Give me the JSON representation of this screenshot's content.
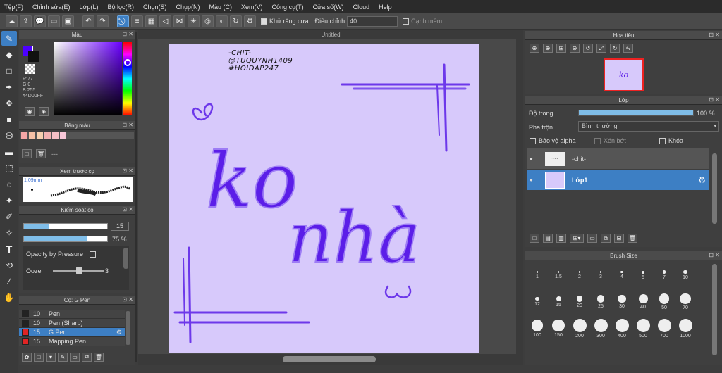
{
  "menu": [
    "Tệp(F)",
    "Chỉnh sửa(E)",
    "Lớp(L)",
    "Bộ lọc(R)",
    "Chọn(S)",
    "Chụp(N)",
    "Màu (C)",
    "Xem(V)",
    "Công cụ(T)",
    "Cửa sổ(W)",
    "Cloud",
    "Help"
  ],
  "toolbar": {
    "antialias_label": "Khử răng cưa",
    "adjust_label": "Điều chỉnh",
    "adjust_value": "40",
    "edge_label": "Cạnh mềm"
  },
  "color_panel": {
    "title": "Màu",
    "r": "R:77",
    "g": "G:0",
    "b": "B:255",
    "hex": "#4D00FF",
    "main_color": "#4d00ff"
  },
  "palette": {
    "title": "Bảng màu",
    "colors": [
      "#f4a6a6",
      "#f6c1a6",
      "#f7d0b0",
      "#f3b3b3",
      "#f5c0c6",
      "#f8c7d8"
    ]
  },
  "brush_preview": {
    "title": "Xem trước cọ",
    "size": "1.09mm"
  },
  "brush_control": {
    "title": "Kiểm soát cọ",
    "size_value": "15",
    "opacity_value": "75 %",
    "opacity_pressure": "Opacity by Pressure",
    "ooze_label": "Ooze",
    "ooze_value": "3",
    "size_fill": 0.3,
    "opacity_fill": 0.75
  },
  "brush_list": {
    "title": "Cọ: G Pen",
    "items": [
      {
        "size": "10",
        "name": "Pen",
        "color": "#222222"
      },
      {
        "size": "10",
        "name": "Pen (Sharp)",
        "color": "#222222"
      },
      {
        "size": "15",
        "name": "G Pen",
        "color": "#e02424"
      },
      {
        "size": "15",
        "name": "Mapping Pen",
        "color": "#e02424"
      }
    ]
  },
  "document": {
    "title": "Untitled"
  },
  "artwork": {
    "credit": [
      "-CHIT-",
      "@TUQUYNH1409",
      "#HOIDAP247"
    ],
    "word1": "ko",
    "word2": "nhà",
    "ink": "#5b1ee8"
  },
  "navigator": {
    "title": "Hoa tiêu"
  },
  "layer_panel": {
    "title": "Lớp",
    "opacity_label": "Độ trong",
    "opacity_value": "100 %",
    "opacity_fill": 1.0,
    "blend_label": "Pha trộn",
    "blend_value": "Bình thường",
    "protect_alpha": "Bảo vệ alpha",
    "clip": "Xén bớt",
    "lock": "Khóa",
    "layers": [
      {
        "name": "-chit-"
      },
      {
        "name": "Lớp1"
      }
    ]
  },
  "brush_size": {
    "title": "Brush Size",
    "sizes": [
      "1",
      "1.5",
      "2",
      "3",
      "4",
      "5",
      "7",
      "10",
      "12",
      "15",
      "20",
      "25",
      "30",
      "40",
      "50",
      "70",
      "100",
      "150",
      "200",
      "300",
      "400",
      "500",
      "700",
      "1000"
    ],
    "dots": [
      1,
      1,
      1,
      1.5,
      2,
      2.5,
      3,
      4,
      4,
      5,
      6,
      8,
      9,
      10,
      11,
      12,
      13,
      14,
      15,
      15,
      15,
      15,
      15,
      15
    ]
  }
}
